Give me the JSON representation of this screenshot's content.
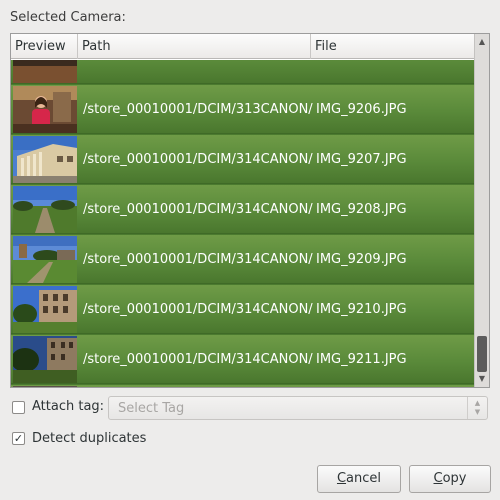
{
  "section_label": "Selected Camera:",
  "table": {
    "columns": [
      "Preview",
      "Path",
      "File"
    ],
    "rows": [
      {
        "path": "",
        "file": "",
        "thumb": "partial-top"
      },
      {
        "path": "/store_00010001/DCIM/313CANON/",
        "file": "IMG_9206.JPG",
        "thumb": "person-indoor"
      },
      {
        "path": "/store_00010001/DCIM/314CANON/",
        "file": "IMG_9207.JPG",
        "thumb": "building-columns"
      },
      {
        "path": "/store_00010001/DCIM/314CANON/",
        "file": "IMG_9208.JPG",
        "thumb": "path-field"
      },
      {
        "path": "/store_00010001/DCIM/314CANON/",
        "file": "IMG_9209.JPG",
        "thumb": "manor-lawn"
      },
      {
        "path": "/store_00010001/DCIM/314CANON/",
        "file": "IMG_9210.JPG",
        "thumb": "manor-side"
      },
      {
        "path": "/store_00010001/DCIM/314CANON/",
        "file": "IMG_9211.JPG",
        "thumb": "manor-dusk"
      },
      {
        "path": "",
        "file": "",
        "thumb": "arch"
      }
    ]
  },
  "attach_tag": {
    "label": "Attach tag:",
    "checked": false,
    "placeholder": "Select Tag"
  },
  "detect_duplicates": {
    "label": "Detect duplicates",
    "checked": true
  },
  "buttons": {
    "cancel_pre": "",
    "cancel_mnemonic": "C",
    "cancel_rest": "ancel",
    "copy_pre": "",
    "copy_mnemonic": "C",
    "copy_rest": "opy"
  },
  "colors": {
    "row_green": "#5a8a3a",
    "window_bg": "#edeceb"
  }
}
